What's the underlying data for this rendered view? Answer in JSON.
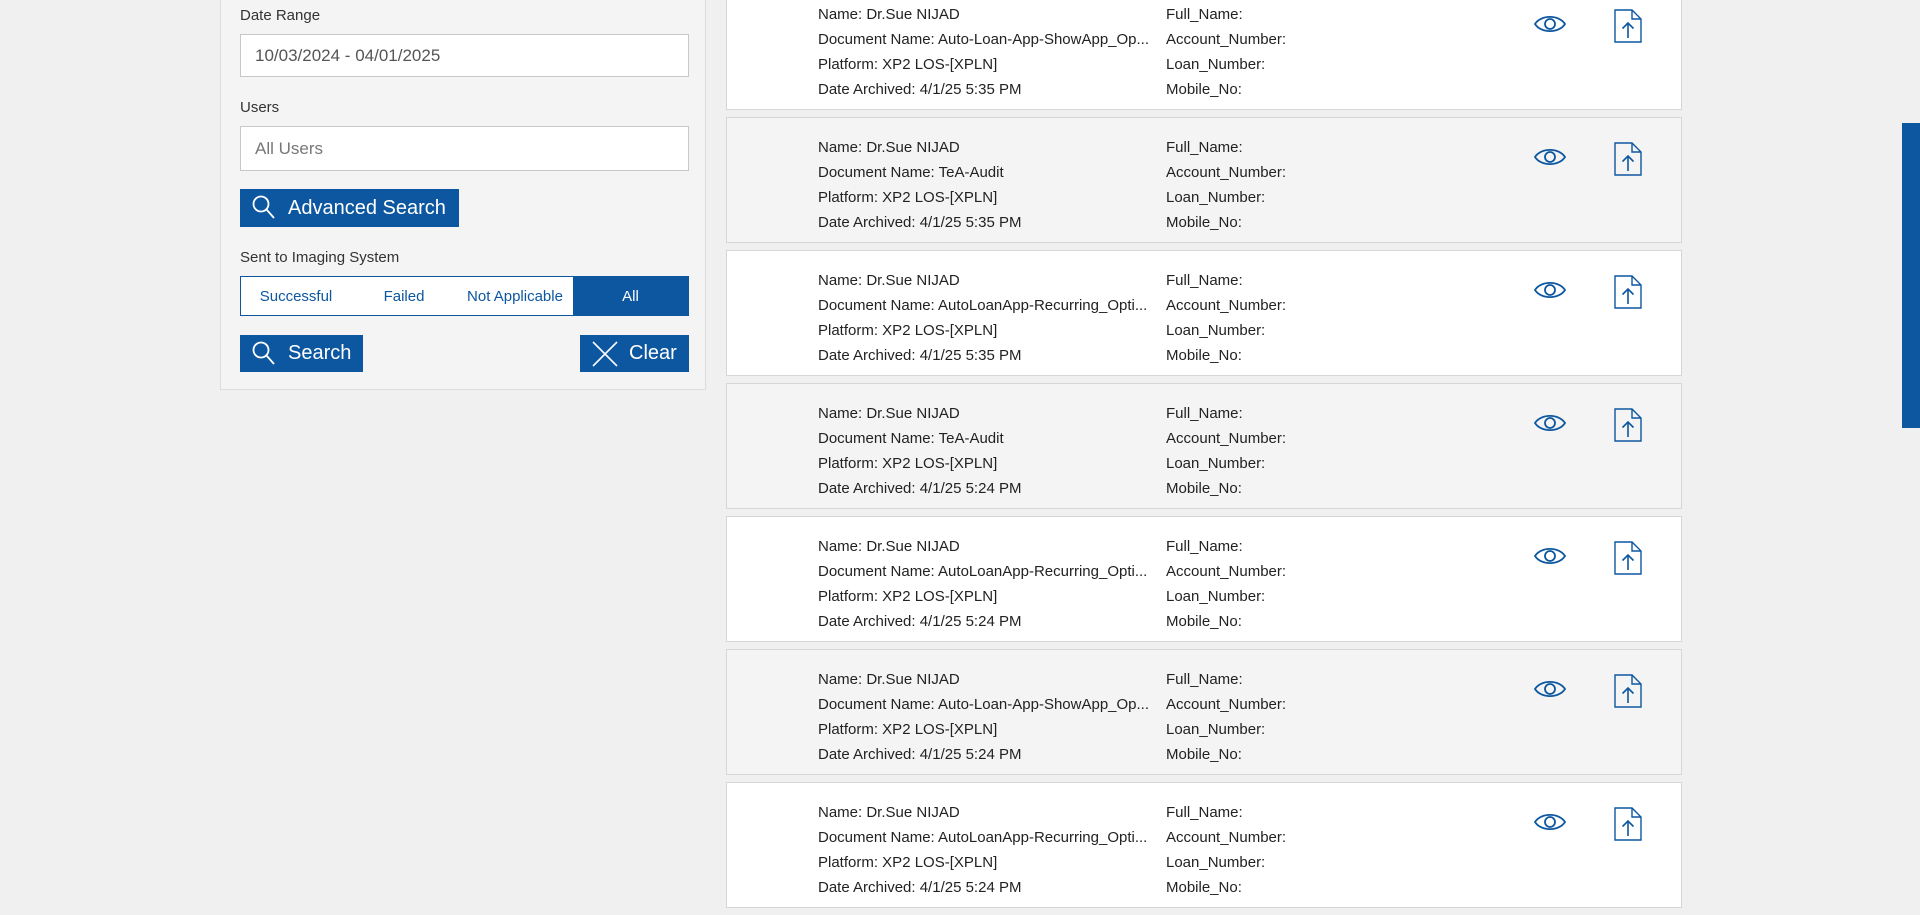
{
  "filters": {
    "date_range_label": "Date Range",
    "date_range_value": "10/03/2024 - 04/01/2025",
    "users_label": "Users",
    "users_placeholder": "All Users",
    "advanced_search_label": "Advanced Search",
    "imaging_label": "Sent to Imaging System",
    "imaging_options": [
      "Successful",
      "Failed",
      "Not Applicable",
      "All"
    ],
    "imaging_selected": "All",
    "search_label": "Search",
    "clear_label": "Clear"
  },
  "results": [
    {
      "name": "Name: Dr.Sue NIJAD",
      "document": "Document Name: Auto-Loan-App-ShowApp_Op...",
      "platform": "Platform: XP2 LOS-[XPLN]",
      "archived": "Date Archived: 4/1/25 5:35 PM",
      "full_name": "Full_Name:",
      "account": "Account_Number:",
      "loan": "Loan_Number:",
      "mobile": "Mobile_No:"
    },
    {
      "name": "Name: Dr.Sue NIJAD",
      "document": "Document Name: TeA-Audit",
      "platform": "Platform: XP2 LOS-[XPLN]",
      "archived": "Date Archived: 4/1/25 5:35 PM",
      "full_name": "Full_Name:",
      "account": "Account_Number:",
      "loan": "Loan_Number:",
      "mobile": "Mobile_No:"
    },
    {
      "name": "Name: Dr.Sue NIJAD",
      "document": "Document Name: AutoLoanApp-Recurring_Opti...",
      "platform": "Platform: XP2 LOS-[XPLN]",
      "archived": "Date Archived: 4/1/25 5:35 PM",
      "full_name": "Full_Name:",
      "account": "Account_Number:",
      "loan": "Loan_Number:",
      "mobile": "Mobile_No:"
    },
    {
      "name": "Name: Dr.Sue NIJAD",
      "document": "Document Name: TeA-Audit",
      "platform": "Platform: XP2 LOS-[XPLN]",
      "archived": "Date Archived: 4/1/25 5:24 PM",
      "full_name": "Full_Name:",
      "account": "Account_Number:",
      "loan": "Loan_Number:",
      "mobile": "Mobile_No:"
    },
    {
      "name": "Name: Dr.Sue NIJAD",
      "document": "Document Name: AutoLoanApp-Recurring_Opti...",
      "platform": "Platform: XP2 LOS-[XPLN]",
      "archived": "Date Archived: 4/1/25 5:24 PM",
      "full_name": "Full_Name:",
      "account": "Account_Number:",
      "loan": "Loan_Number:",
      "mobile": "Mobile_No:"
    },
    {
      "name": "Name: Dr.Sue NIJAD",
      "document": "Document Name: Auto-Loan-App-ShowApp_Op...",
      "platform": "Platform: XP2 LOS-[XPLN]",
      "archived": "Date Archived: 4/1/25 5:24 PM",
      "full_name": "Full_Name:",
      "account": "Account_Number:",
      "loan": "Loan_Number:",
      "mobile": "Mobile_No:"
    },
    {
      "name": "Name: Dr.Sue NIJAD",
      "document": "Document Name: AutoLoanApp-Recurring_Opti...",
      "platform": "Platform: XP2 LOS-[XPLN]",
      "archived": "Date Archived: 4/1/25 5:24 PM",
      "full_name": "Full_Name:",
      "account": "Account_Number:",
      "loan": "Loan_Number:",
      "mobile": "Mobile_No:"
    }
  ],
  "icons": {
    "view": "eye-icon",
    "export": "file-upload-icon",
    "search": "search-icon",
    "clear": "close-icon"
  },
  "colors": {
    "accent": "#0d57a0",
    "page_background": "#f0f0f0",
    "card_alt": "#f4f4f4",
    "card": "#ffffff"
  }
}
